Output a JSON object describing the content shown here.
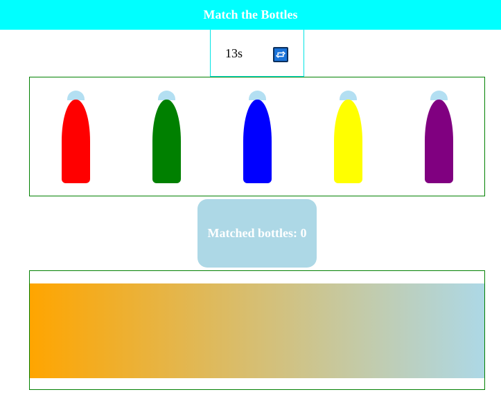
{
  "header": {
    "title": "Match the Bottles"
  },
  "timer": {
    "value": "13s",
    "restart_icon": "refresh-icon"
  },
  "bottles": [
    {
      "color": "#ff0000",
      "name": "red"
    },
    {
      "color": "#008000",
      "name": "green"
    },
    {
      "color": "#0000ff",
      "name": "blue"
    },
    {
      "color": "#ffff00",
      "name": "yellow"
    },
    {
      "color": "#800080",
      "name": "purple"
    }
  ],
  "score": {
    "text": "Matched bottles: 0"
  },
  "target": {
    "gradient_start": "#ffa500",
    "gradient_end": "#add8e6"
  },
  "colors": {
    "header_bg": "#00ffff",
    "panel_border": "#008000",
    "cap": "#b3dff2",
    "score_bg": "#add8e6"
  }
}
